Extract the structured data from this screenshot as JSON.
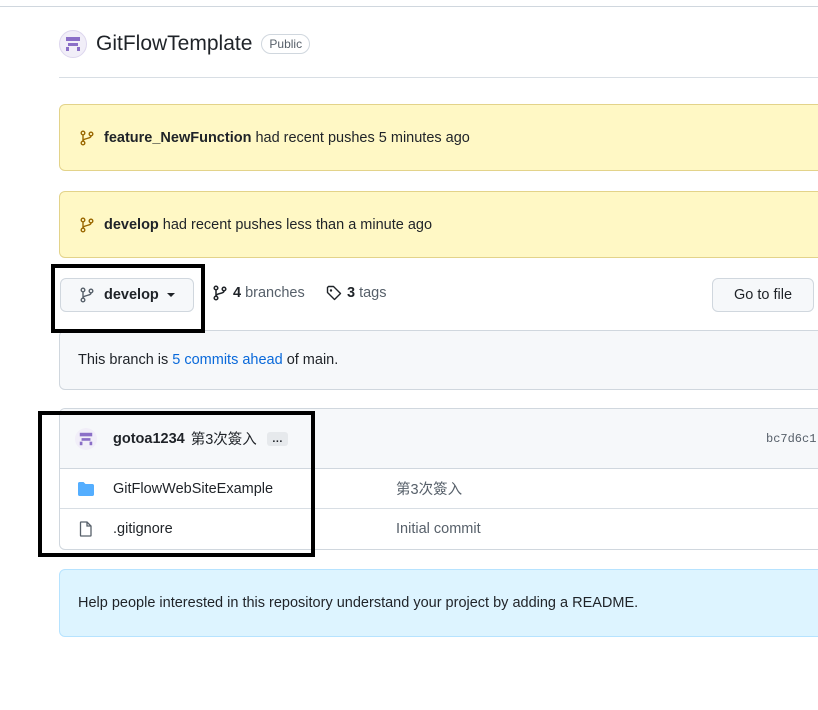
{
  "repo": {
    "name": "GitFlowTemplate",
    "visibility": "Public"
  },
  "banners": [
    {
      "branch": "feature_NewFunction",
      "text": "had recent pushes 5 minutes ago"
    },
    {
      "branch": "develop",
      "text": "had recent pushes less than a minute ago"
    }
  ],
  "toolbar": {
    "current_branch": "develop",
    "branches_count": "4",
    "branches_label": "branches",
    "tags_count": "3",
    "tags_label": "tags",
    "goto_file_label": "Go to file"
  },
  "ahead": {
    "prefix": "This branch is",
    "link": "5 commits ahead",
    "suffix": "of main."
  },
  "latest_commit": {
    "user": "gotoa1234",
    "message": "第3次簽入",
    "more": "…",
    "sha": "bc7d6c1"
  },
  "files": [
    {
      "name": "GitFlowWebSiteExample",
      "commit": "第3次簽入",
      "icon": "folder-icon"
    },
    {
      "name": ".gitignore",
      "commit": "Initial commit",
      "icon": "file-icon"
    }
  ],
  "readme_notice": "Help people interested in this repository understand your project by adding a README.",
  "colors": {
    "banner_bg": "#fff8c5",
    "link": "#0969da",
    "folder": "#54aeff",
    "readme_bg": "#ddf4ff",
    "highlight_border": "#000000"
  }
}
